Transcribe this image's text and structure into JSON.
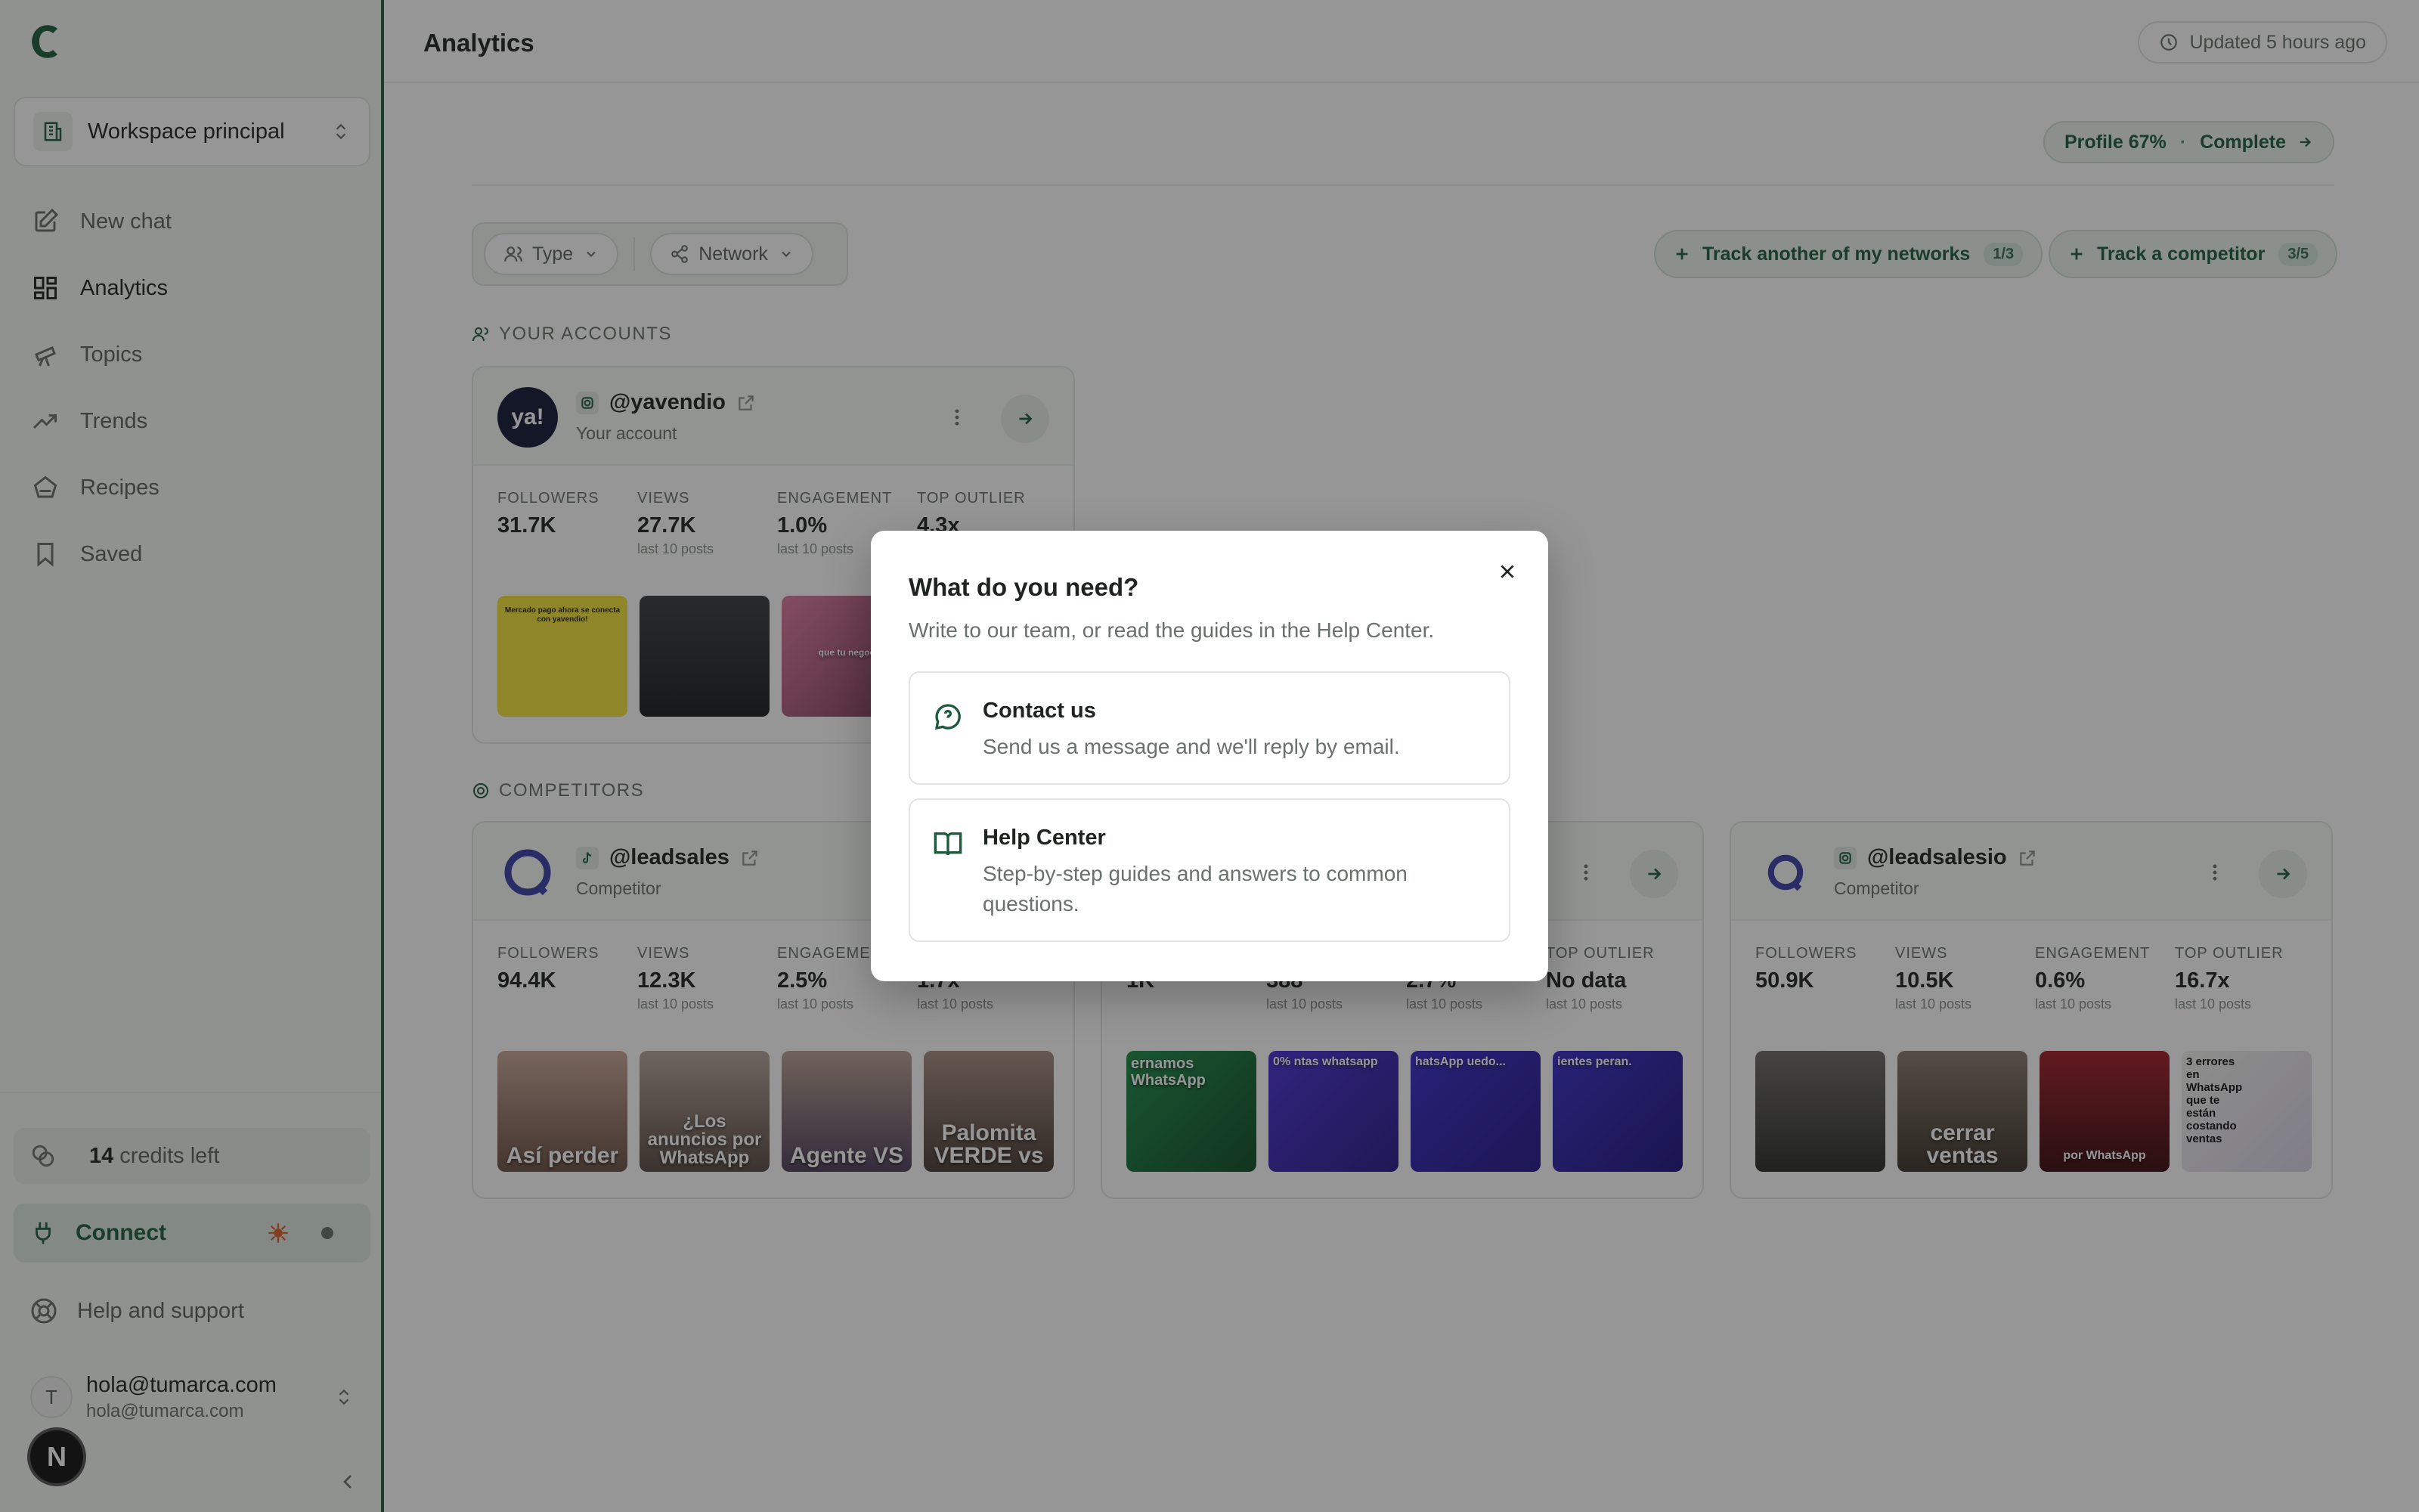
{
  "sidebar": {
    "workspace": "Workspace principal",
    "nav": [
      {
        "label": "New chat",
        "icon": "edit-icon"
      },
      {
        "label": "Analytics",
        "icon": "grid-icon"
      },
      {
        "label": "Topics",
        "icon": "telescope-icon"
      },
      {
        "label": "Trends",
        "icon": "trending-icon"
      },
      {
        "label": "Recipes",
        "icon": "chef-hat-icon"
      },
      {
        "label": "Saved",
        "icon": "bookmark-icon"
      }
    ],
    "credits_count": "14",
    "credits_label": "credits left",
    "connect_label": "Connect",
    "help_label": "Help and support",
    "user_name": "hola@tumarca.com",
    "user_email": "hola@tumarca.com",
    "user_initial": "T",
    "badge": "N"
  },
  "header": {
    "title": "Analytics",
    "updated": "Updated 5 hours ago",
    "profile_label": "Profile 67%",
    "profile_sep": "·",
    "profile_action": "Complete"
  },
  "filters": {
    "type": "Type",
    "network": "Network"
  },
  "track": {
    "mine_label": "Track another of my networks",
    "mine_count": "1/3",
    "competitor_label": "Track a competitor",
    "competitor_count": "3/5"
  },
  "sections": {
    "accounts": "YOUR ACCOUNTS",
    "competitors": "COMPETITORS"
  },
  "stat_labels": {
    "followers": "FOLLOWERS",
    "views": "VIEWS",
    "engagement": "ENGAGEMENT",
    "outlier": "TOP OUTLIER",
    "sub": "last 10 posts"
  },
  "cards": {
    "yavendio": {
      "handle": "@yavendio",
      "sub": "Your account",
      "avatar_text": "ya!",
      "followers": "31.7K",
      "views": "27.7K",
      "engagement": "1.0%",
      "outlier": "4.3x",
      "thumbs": [
        "Mercado pago ahora se conecta con yavendio!",
        "",
        "que tu negoc"
      ]
    },
    "leadsales": {
      "handle": "@leadsales",
      "sub": "Competitor",
      "followers": "94.4K",
      "views": "12.3K",
      "engagement": "2.5%",
      "outlier": "1.7x",
      "thumbs": [
        "Así perder",
        "¿Los anuncios por WhatsApp",
        "Agente VS",
        "Palomita VERDE vs"
      ]
    },
    "middle": {
      "followers": "1K",
      "views": "388",
      "engagement": "2.7%",
      "outlier": "No data",
      "thumbs": [
        "ernamos WhatsApp",
        "0% ntas whatsapp",
        "hatsApp uedo...",
        "ientes peran."
      ]
    },
    "leadsalesio": {
      "handle": "@leadsalesio",
      "sub": "Competitor",
      "followers": "50.9K",
      "views": "10.5K",
      "engagement": "0.6%",
      "outlier": "16.7x",
      "thumbs": [
        "",
        "cerrar ventas",
        "por WhatsApp",
        "3 errores en WhatsApp que te están costando ventas"
      ]
    }
  },
  "modal": {
    "title": "What do you need?",
    "description": "Write to our team, or read the guides in the Help Center.",
    "contact_title": "Contact us",
    "contact_desc": "Send us a message and we'll reply by email.",
    "help_title": "Help Center",
    "help_desc": "Step-by-step guides and answers to common questions."
  },
  "colors": {
    "brand": "#1e5b3e",
    "accent_bg": "#eef5f0"
  }
}
